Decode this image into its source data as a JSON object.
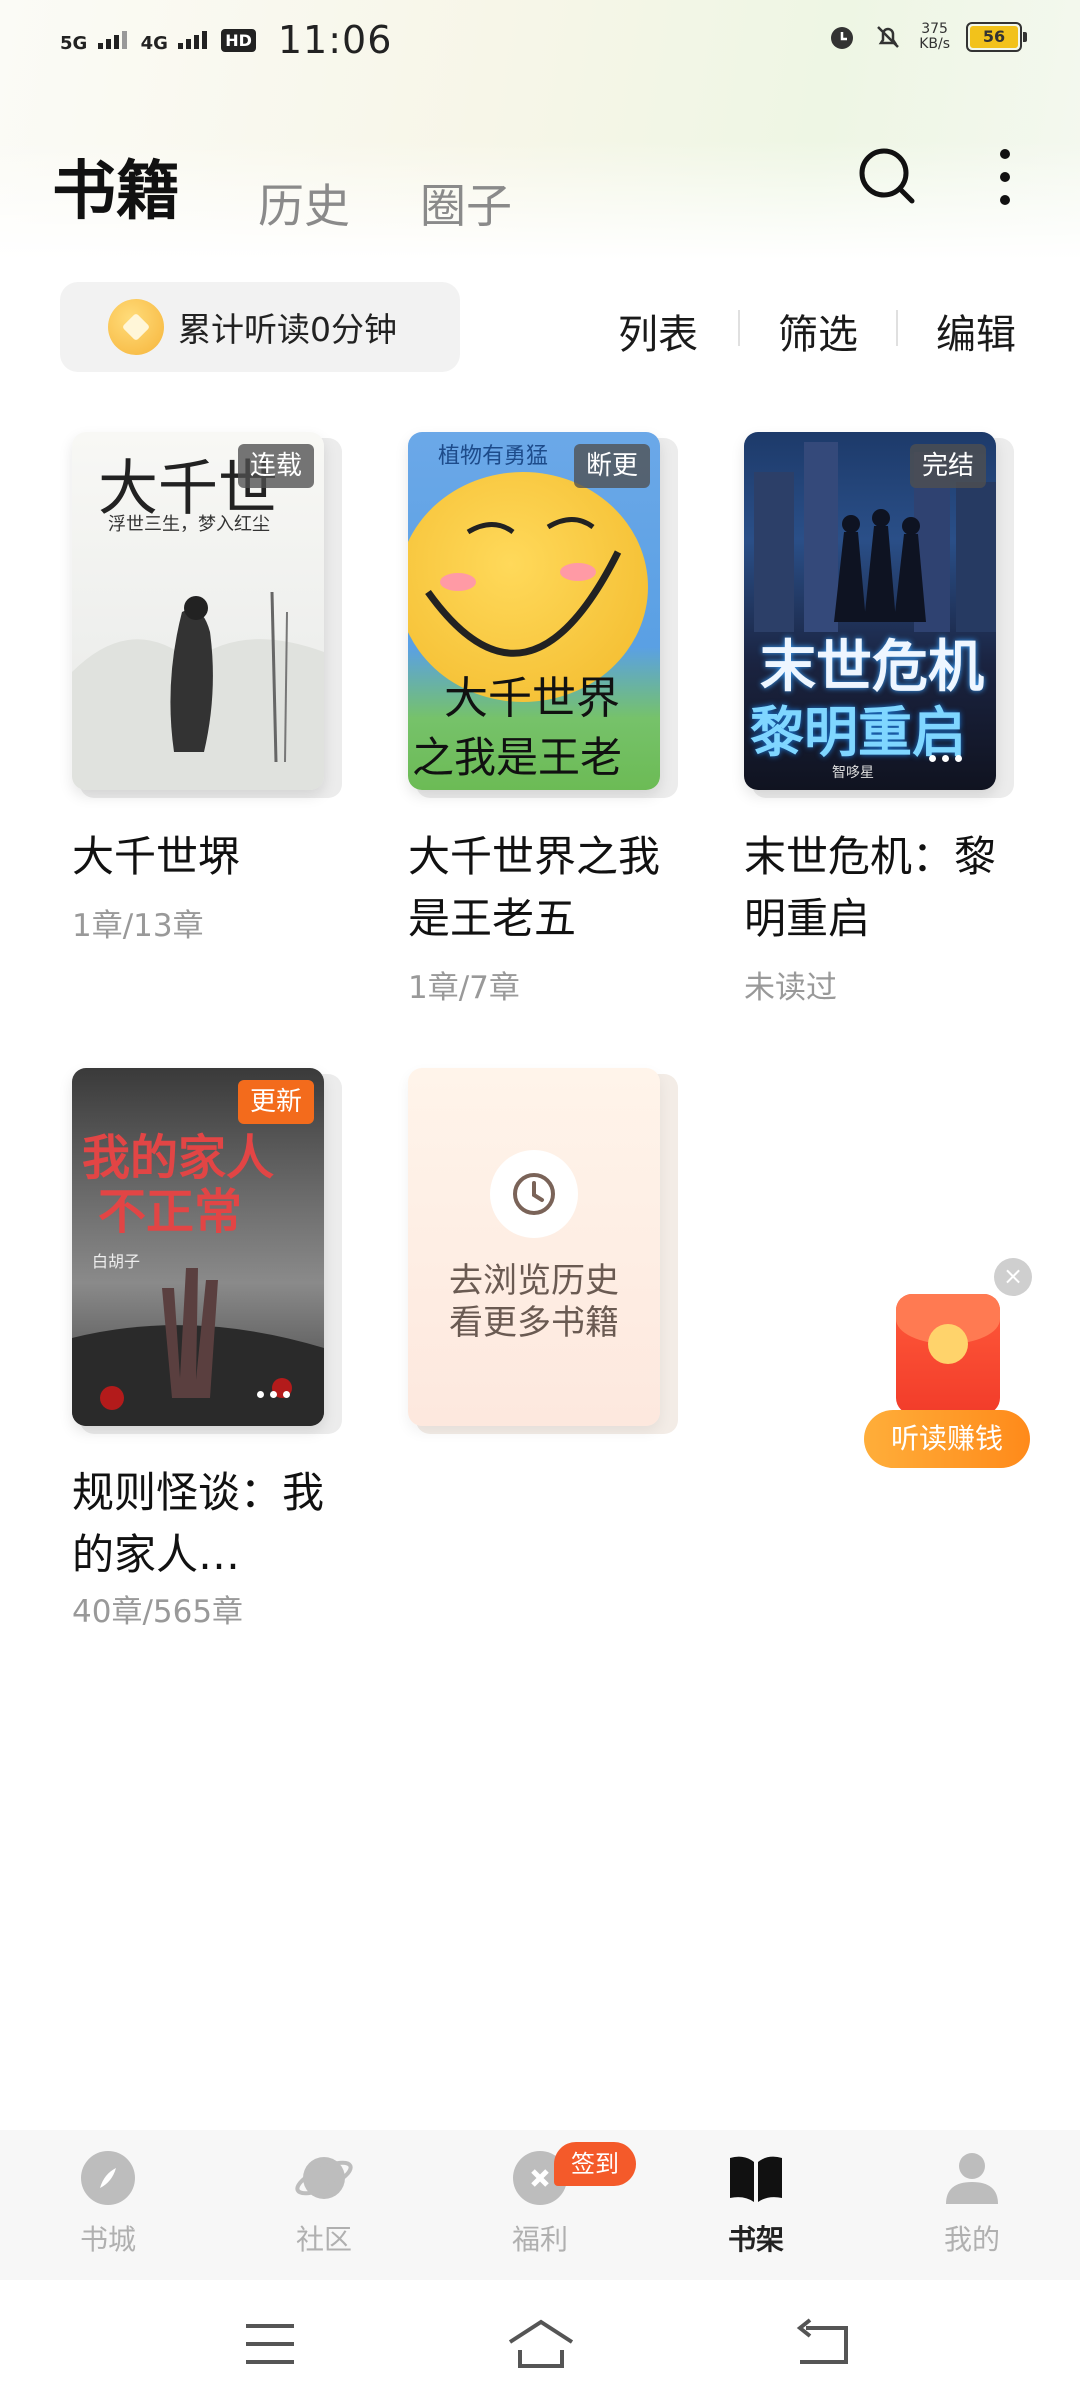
{
  "status_bar": {
    "net1": "5G",
    "net2": "4G",
    "hd": "HD",
    "time": "11:06",
    "speed_value": "375",
    "speed_unit": "KB/s",
    "battery": "56"
  },
  "header": {
    "tab_books": "书籍",
    "tab_history": "历史",
    "tab_circle": "圈子"
  },
  "toolbar": {
    "listen_summary": "累计听读0分钟",
    "list": "列表",
    "filter": "筛选",
    "edit": "编辑"
  },
  "books": [
    {
      "title": "大千世堺",
      "progress": "1章/13章",
      "badge": "连载",
      "cover_text": "大千世",
      "cover_sub": "浮世三生，梦入红尘"
    },
    {
      "title": "大千世界之我是王老五",
      "progress": "1章/7章",
      "badge": "断更",
      "cover_top": "植物有勇猛",
      "cover_line1": "大千世界",
      "cover_line2": "之我是王老五"
    },
    {
      "title": "末世危机：黎明重启",
      "progress": "未读过",
      "badge": "完结",
      "cover_line1": "末世危机",
      "cover_line2": "黎明重启",
      "cover_author": "智哆星"
    },
    {
      "title": "规则怪谈：我的家人…",
      "progress": "40章/565章",
      "badge": "更新",
      "cover_line1": "我的家人",
      "cover_line2": "不正常",
      "cover_author": "白胡子"
    }
  ],
  "history_card": {
    "line1": "去浏览历史",
    "line2": "看更多书籍"
  },
  "floating": {
    "close": "×",
    "earn": "听读赚钱"
  },
  "bottom_nav": {
    "items": [
      {
        "label": "书城",
        "icon": "compass-icon"
      },
      {
        "label": "社区",
        "icon": "planet-icon"
      },
      {
        "label": "福利",
        "icon": "gift-icon"
      },
      {
        "label": "书架",
        "icon": "book-open-icon"
      },
      {
        "label": "我的",
        "icon": "person-icon"
      }
    ],
    "active": "书架",
    "sign_badge": "签到"
  },
  "colors": {
    "accent_orange": "#f36b1c",
    "active_nav": "#222222",
    "inactive_nav": "#b0b0b0"
  }
}
